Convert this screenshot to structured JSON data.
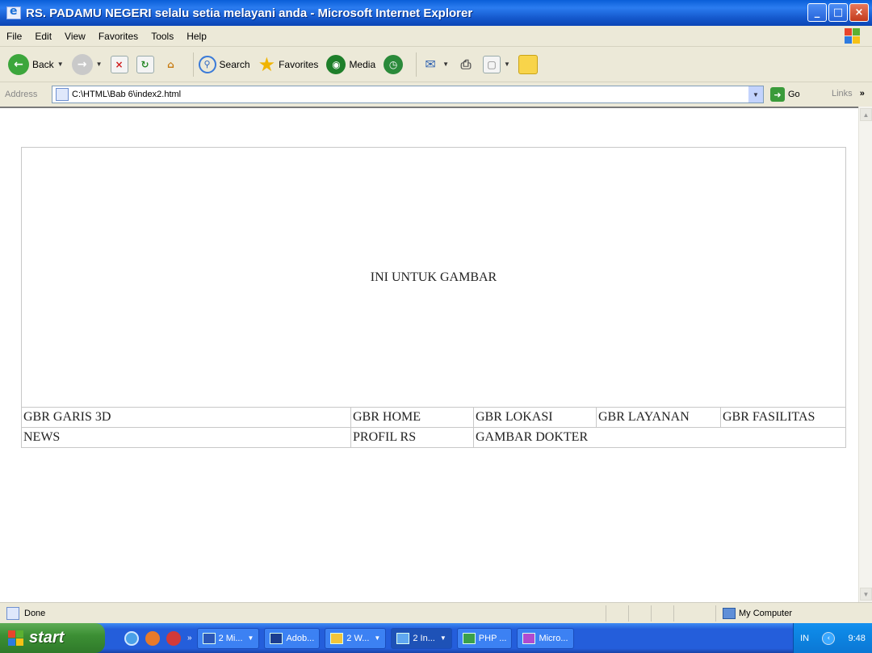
{
  "window": {
    "title": "RS. PADAMU NEGERI selalu setia melayani anda - Microsoft Internet Explorer",
    "controls": [
      "_",
      "□",
      "×"
    ]
  },
  "menu": [
    "File",
    "Edit",
    "View",
    "Favorites",
    "Tools",
    "Help"
  ],
  "toolbar": {
    "back_label": "Back",
    "search_label": "Search",
    "favorites_label": "Favorites",
    "media_label": "Media"
  },
  "address": {
    "label": "Address",
    "value": "C:\\HTML\\Bab 6\\index2.html",
    "go_label": "Go",
    "links_label": "Links",
    "links_more": "»"
  },
  "page": {
    "banner": "INI UNTUK GAMBAR",
    "row1": [
      "GBR GARIS 3D",
      "GBR HOME",
      "GBR LOKASI",
      "GBR LAYANAN",
      "GBR FASILITAS"
    ],
    "row2": [
      "NEWS",
      "PROFIL RS",
      "GAMBAR DOKTER"
    ]
  },
  "status": {
    "text": "Done",
    "zone": "My Computer"
  },
  "taskbar": {
    "start_label": "start",
    "tasks": [
      "2 Mi...",
      "Adob...",
      "2 W...",
      "2 In...",
      "PHP ...",
      "Micro..."
    ],
    "lang": "IN",
    "time": "9:48"
  }
}
